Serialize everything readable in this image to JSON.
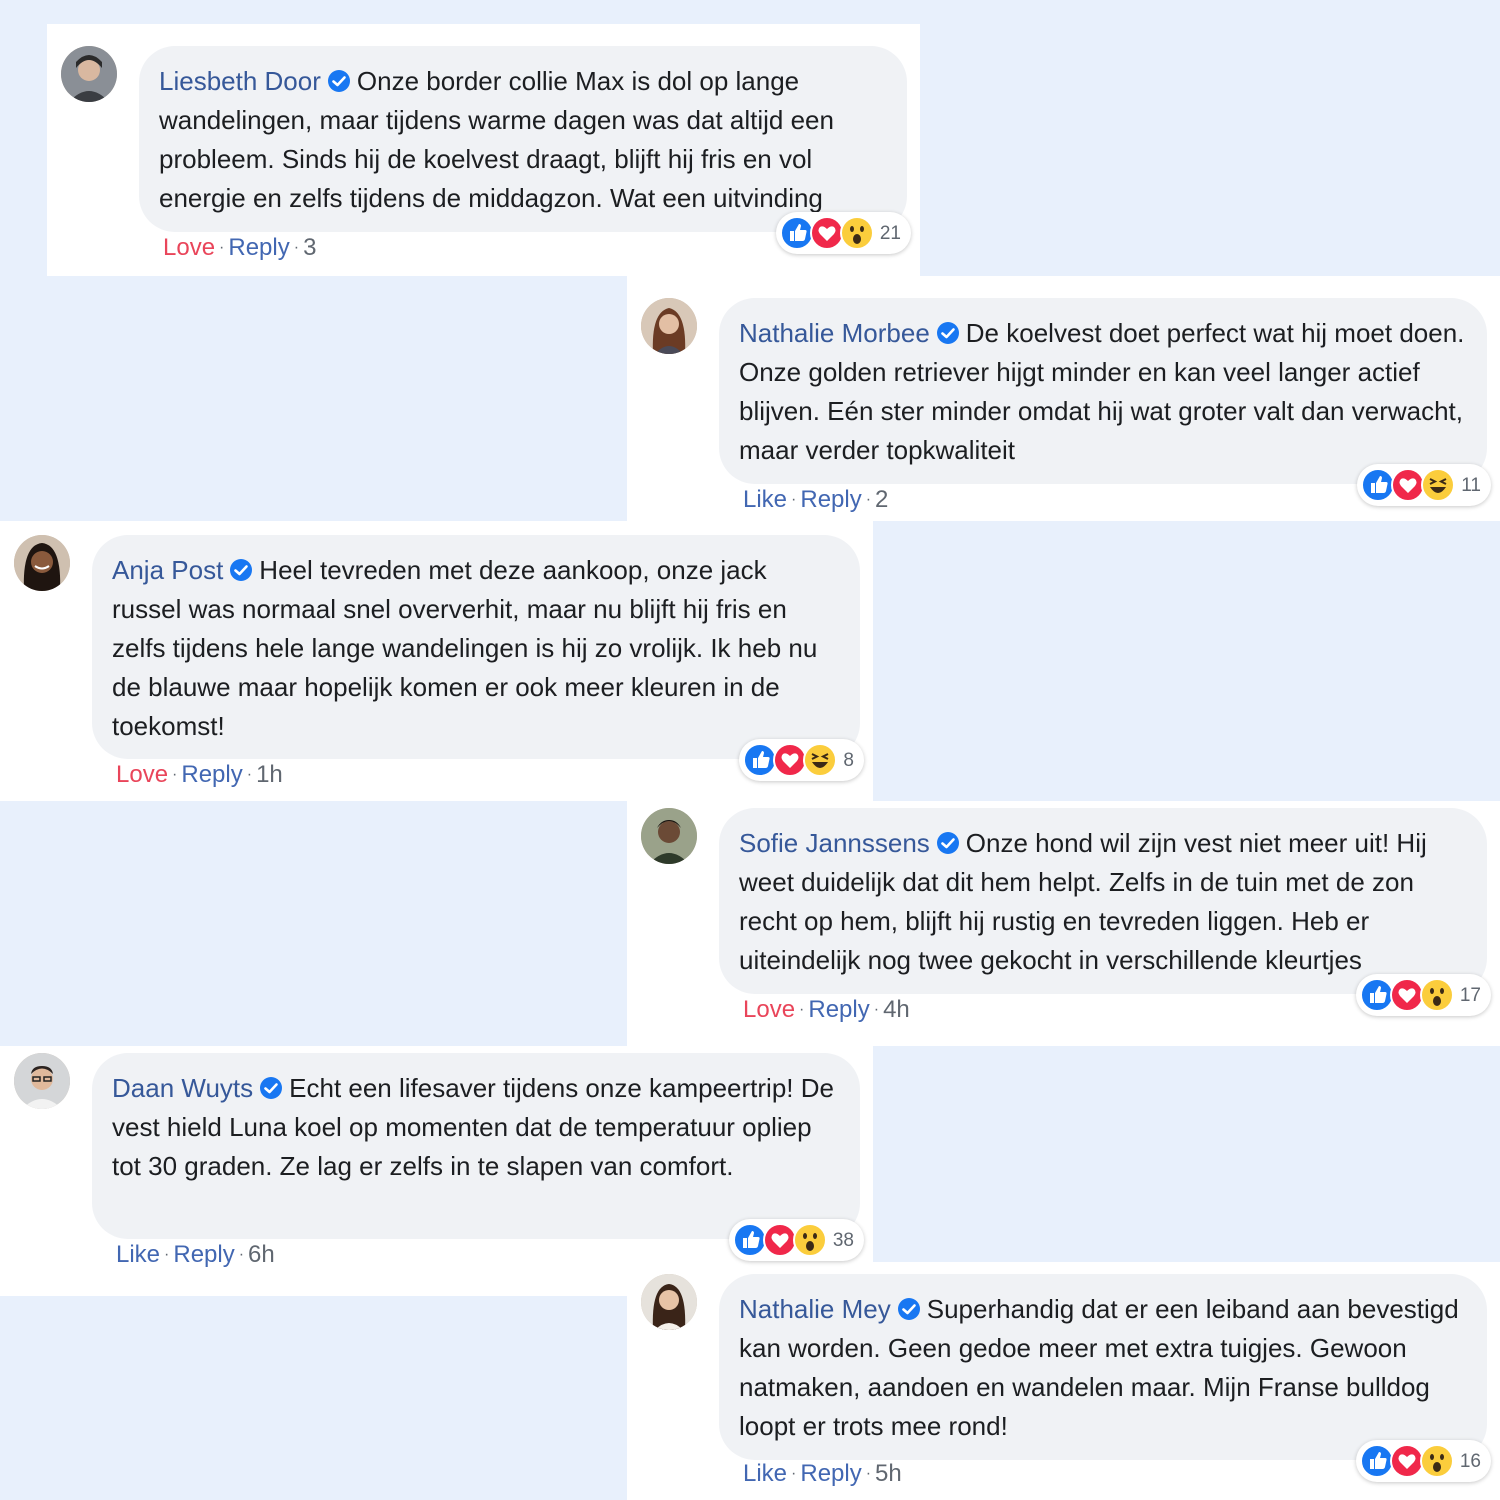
{
  "comments": [
    {
      "name": "Liesbeth Door",
      "text": "Onze border collie Max is dol op lange wandelingen, maar tijdens warme dagen was dat altijd een probleem. Sinds hij de koelvest draagt, blijft hij fris en vol energie en zelfs tijdens de middagzon. Wat een uitvinding",
      "reactions": [
        "like-icon",
        "love-icon",
        "wow-icon"
      ],
      "reaction_count": "21",
      "action": "Love",
      "reply": "Reply",
      "meta": "3"
    },
    {
      "name": "Nathalie Morbee",
      "text": "De koelvest doet perfect wat hij moet doen. Onze golden retriever hijgt minder en kan veel langer actief blijven. Eén ster minder omdat hij wat groter valt dan verwacht, maar verder topkwaliteit",
      "reactions": [
        "like-icon",
        "love-icon",
        "haha-icon"
      ],
      "reaction_count": "11",
      "action": "Like",
      "reply": "Reply",
      "meta": "2"
    },
    {
      "name": "Anja Post",
      "text": "Heel tevreden met deze aankoop, onze jack russel was normaal snel oververhit, maar nu blijft hij fris en zelfs tijdens hele lange wandelingen is hij zo vrolijk. Ik heb nu de blauwe maar hopelijk komen er ook meer kleuren in de toekomst!",
      "reactions": [
        "like-icon",
        "love-icon",
        "haha-icon"
      ],
      "reaction_count": "8",
      "action": "Love",
      "reply": "Reply",
      "meta": "1h"
    },
    {
      "name": "Sofie Jannssens",
      "text": "Onze hond wil zijn vest niet meer uit! Hij weet duidelijk dat dit hem helpt. Zelfs in de tuin met de zon recht op hem, blijft hij rustig en tevreden liggen. Heb er uiteindelijk nog twee gekocht in verschillende kleurtjes",
      "reactions": [
        "like-icon",
        "love-icon",
        "wow-icon"
      ],
      "reaction_count": "17",
      "action": "Love",
      "reply": "Reply",
      "meta": "4h"
    },
    {
      "name": "Daan Wuyts",
      "text": "Echt een lifesaver tijdens onze kampeertrip! De vest hield Luna koel op momenten dat de temperatuur opliep tot 30 graden. Ze lag er zelfs in te slapen van comfort.",
      "reactions": [
        "like-icon",
        "love-icon",
        "wow-icon"
      ],
      "reaction_count": "38",
      "action": "Like",
      "reply": "Reply",
      "meta": "6h"
    },
    {
      "name": "Nathalie Mey",
      "text": "Superhandig dat er een leiband aan bevestigd kan worden. Geen gedoe meer met extra tuigjes. Gewoon natmaken, aandoen en wandelen maar. Mijn Franse bulldog loopt er trots mee rond!",
      "reactions": [
        "like-icon",
        "love-icon",
        "wow-icon"
      ],
      "reaction_count": "16",
      "action": "Like",
      "reply": "Reply",
      "meta": "5h"
    }
  ],
  "colors": {
    "background": "#e8f0fc",
    "name": "#365899",
    "link": "#4267b2",
    "love": "#e9455a",
    "bubble": "#f0f2f5",
    "verified": "#1877f2"
  }
}
